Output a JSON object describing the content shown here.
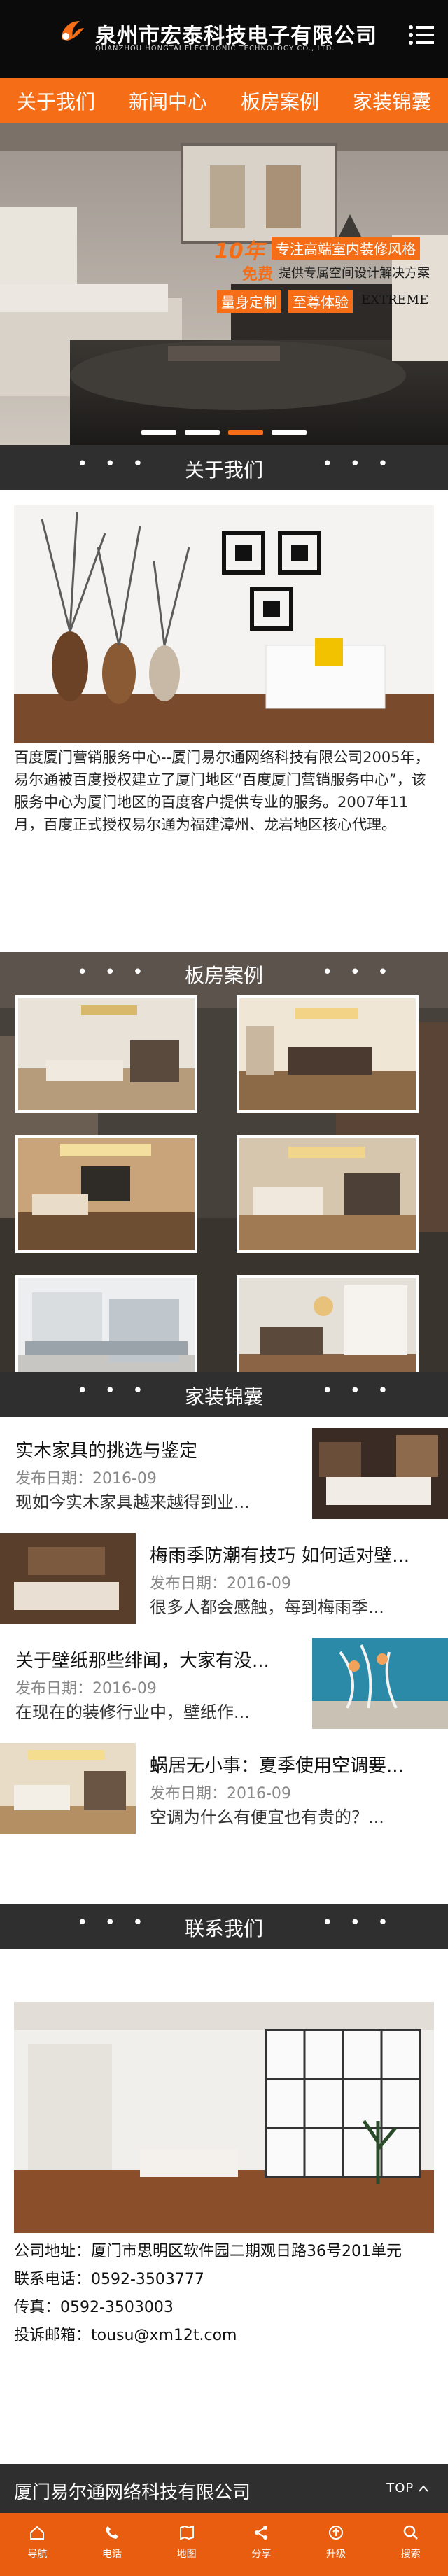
{
  "header": {
    "title": "泉州市宏泰科技电子有限公司",
    "subtitle": "QUANZHOU HONGTAI ELECTRONIC TECHNOLOGY CO., LTD."
  },
  "nav": [
    "关于我们",
    "新闻中心",
    "板房案例",
    "家装锦囊"
  ],
  "banner": {
    "line1": "10年",
    "line1b": "专注高端室内装修风格",
    "line2": "免费",
    "line2b": "提供专属空间设计解决方案",
    "tag1": "量身定制",
    "tag2": "至尊体验",
    "tag3": "EXTREME",
    "active_slide": 2,
    "slides": 4
  },
  "about": {
    "heading": "关于我们",
    "text": "百度厦门营销服务中心--厦门易尔通网络科技有限公司2005年，易尔通被百度授权建立了厦门地区“百度厦门营销服务中心”，该服务中心为厦门地区的百度客户提供专业的服务。2007年11月，百度正式授权易尔通为福建漳州、龙岩地区核心代理。"
  },
  "cases": {
    "heading": "板房案例"
  },
  "news": {
    "heading": "家装锦囊",
    "items": [
      {
        "title": "实木家具的挑选与鉴定",
        "date": "发布日期：2016-09",
        "desc": "现如今实木家具越来越得到业..."
      },
      {
        "title": "梅雨季防潮有技巧 如何适对壁...",
        "date": "发布日期：2016-09",
        "desc": "很多人都会感触，每到梅雨季..."
      },
      {
        "title": "关于壁纸那些绯闻，大家有没...",
        "date": "发布日期：2016-09",
        "desc": "在现在的装修行业中，壁纸作..."
      },
      {
        "title": "蜗居无小事：夏季使用空调要...",
        "date": "发布日期：2016-09",
        "desc": "空调为什么有便宜也有贵的？..."
      }
    ]
  },
  "contact": {
    "heading": "联系我们",
    "address": "公司地址：厦门市思明区软件园二期观日路36号201单元",
    "phone": "联系电话：0592-3503777",
    "fax": "传真：0592-3503003",
    "email": "投诉邮箱：tousu@xm12t.com"
  },
  "footer": {
    "company": "厦门易尔通网络科技有限公司",
    "top": "TOP"
  },
  "bottomnav": [
    {
      "label": "导航",
      "icon": "home-icon"
    },
    {
      "label": "电话",
      "icon": "phone-icon"
    },
    {
      "label": "地图",
      "icon": "map-icon"
    },
    {
      "label": "分享",
      "icon": "share-icon"
    },
    {
      "label": "升级",
      "icon": "upgrade-icon"
    },
    {
      "label": "搜索",
      "icon": "search-icon"
    }
  ],
  "colors": {
    "accent": "#f56d16",
    "dark": "#2f2f2f",
    "header": "#0b0b0b"
  }
}
